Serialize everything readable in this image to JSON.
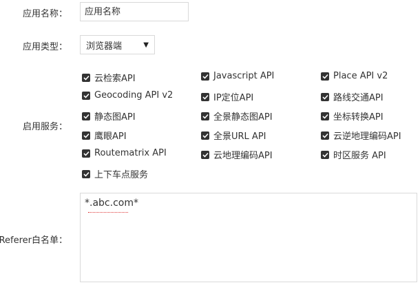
{
  "form": {
    "app_name_label": "应用名称：",
    "app_name_placeholder": "应用名称",
    "app_type_label": "应用类型：",
    "app_type_value": "浏览器端",
    "services_label": "启用服务：",
    "referer_label": "Referer白名单：",
    "referer_value": "*.abc.com*"
  },
  "services": [
    "云检索API",
    "Javascript API",
    "Place API v2",
    "Geocoding API v2",
    "IP定位API",
    "路线交通API",
    "静态图API",
    "全景静态图API",
    "坐标转换API",
    "鹰眼API",
    "全景URL API",
    "云逆地理编码API",
    "Routematrix API",
    "云地理编码API",
    "时区服务 API",
    "上下车点服务"
  ],
  "colors": {
    "checkbox": "#333333",
    "border": "#d9d9d9"
  },
  "icons": {
    "select_arrow": "caret-down-icon",
    "checkbox": "check-icon"
  }
}
